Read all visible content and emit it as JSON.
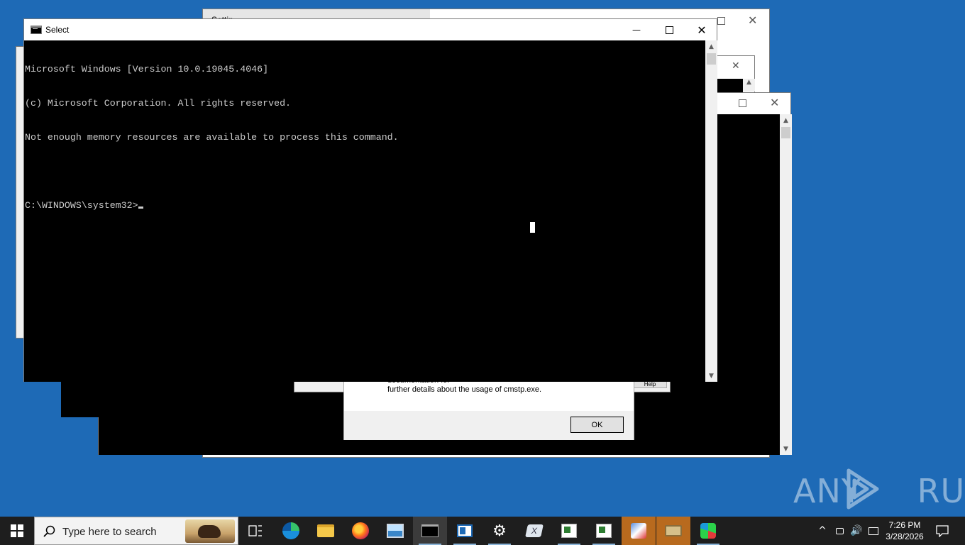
{
  "bg_windows": {
    "settings_title": "Settin",
    "dialog_text_line1": "documentation for",
    "dialog_text_line2": "further details about the usage of cmstp.exe.",
    "ok_label": "OK",
    "help_label": "Help"
  },
  "cmd": {
    "title": "Select",
    "lines": [
      "Microsoft Windows [Version 10.0.19045.4046]",
      "(c) Microsoft Corporation. All rights reserved.",
      "Not enough memory resources are available to process this command.",
      "",
      "C:\\WINDOWS\\system32>"
    ],
    "minimize": "—",
    "maximize": "☐",
    "close": "✕"
  },
  "watermark": {
    "text": "ANY RUN"
  },
  "taskbar": {
    "search_placeholder": "Type here to search",
    "clock_time": "7:26 PM",
    "clock_date": "3/28/2026",
    "pinned": [
      "task-view",
      "edge",
      "file-explorer",
      "firefox",
      "photos",
      "cmd",
      "app-window",
      "settings",
      "app-x",
      "app-doc",
      "app-doc2",
      "app-install",
      "app-package",
      "app-green"
    ]
  },
  "colors": {
    "desktop": "#1e6ab6",
    "taskbar": "#1e1e1e",
    "console": "#000000",
    "highlight": "#b86a1e"
  }
}
